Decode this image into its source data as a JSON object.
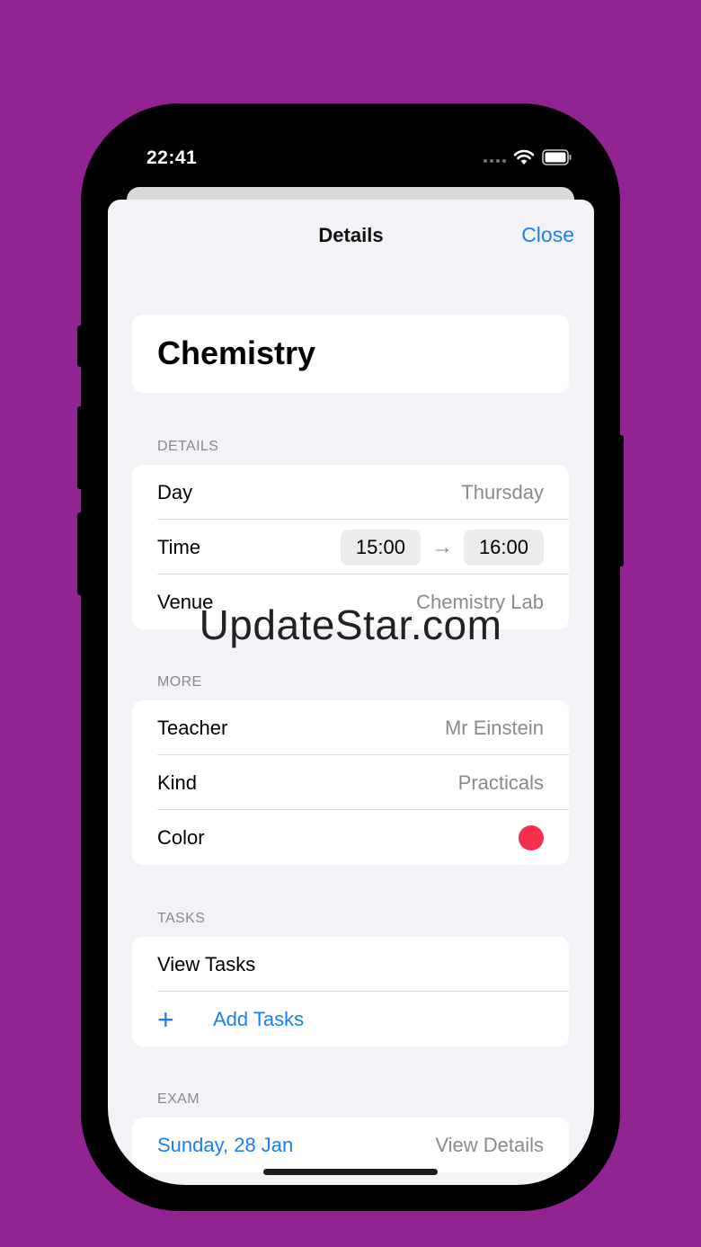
{
  "status_bar": {
    "time": "22:41"
  },
  "nav": {
    "title": "Details",
    "close_label": "Close"
  },
  "subject": {
    "name": "Chemistry"
  },
  "details_section": {
    "header": "DETAILS",
    "day_label": "Day",
    "day_value": "Thursday",
    "time_label": "Time",
    "time_start": "15:00",
    "time_arrow": "→",
    "time_end": "16:00",
    "venue_label": "Venue",
    "venue_value": "Chemistry Lab"
  },
  "more_section": {
    "header": "MORE",
    "teacher_label": "Teacher",
    "teacher_value": "Mr Einstein",
    "kind_label": "Kind",
    "kind_value": "Practicals",
    "color_label": "Color",
    "color_value": "#f4304d"
  },
  "tasks_section": {
    "header": "TASKS",
    "view_tasks_label": "View Tasks",
    "add_tasks_label": "Add Tasks",
    "plus_icon": "+"
  },
  "exam_section": {
    "header": "EXAM",
    "date": "Sunday, 28 Jan",
    "view_details_label": "View Details"
  },
  "watermark": "UpdateStar.com",
  "colors": {
    "background": "#922393",
    "accent": "#1a7ff3",
    "sheet": "#f2f2f7"
  }
}
